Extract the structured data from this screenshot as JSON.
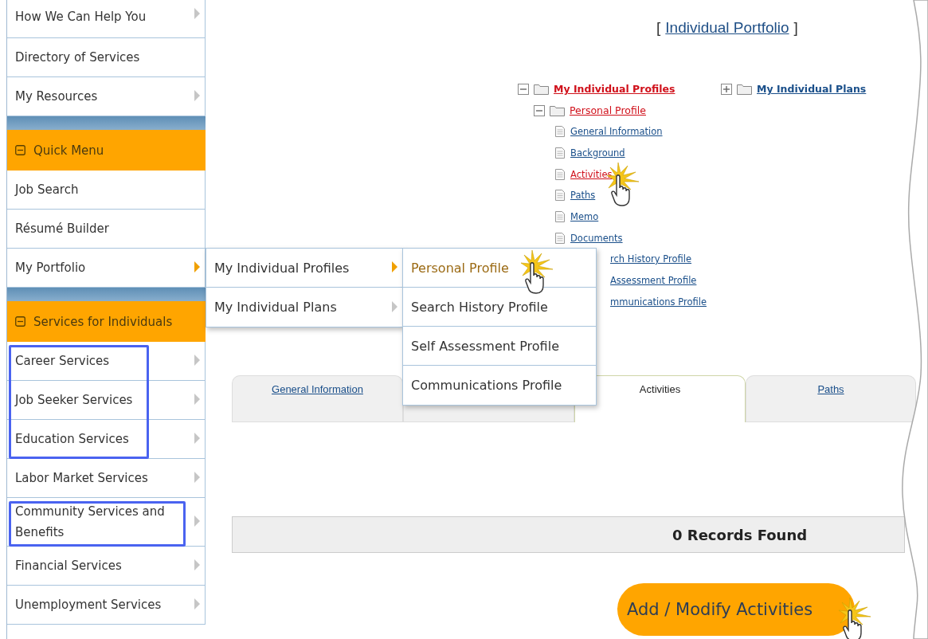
{
  "sidebar": [
    {
      "kind": "links",
      "items": [
        {
          "label": "How We Can Help You",
          "has_submenu": true,
          "expanded": false
        },
        {
          "label": "Directory of Services",
          "has_submenu": false,
          "expanded": false
        },
        {
          "label": "My Resources",
          "has_submenu": true,
          "expanded": false
        }
      ]
    },
    {
      "kind": "menu",
      "title": "Quick Menu",
      "expanded": true,
      "items": [
        {
          "label": "Job Search",
          "has_submenu": false,
          "expanded": false
        },
        {
          "label": "Résumé Builder",
          "has_submenu": false,
          "expanded": false
        },
        {
          "label": "My Portfolio",
          "has_submenu": true,
          "expanded": true
        }
      ]
    },
    {
      "kind": "menu",
      "title": "Services for Individuals",
      "expanded": true,
      "items": [
        {
          "label": "Career Services",
          "has_submenu": true,
          "expanded": false,
          "highlighted": true
        },
        {
          "label": "Job Seeker Services",
          "has_submenu": true,
          "expanded": false,
          "highlighted": true
        },
        {
          "label": "Education Services",
          "has_submenu": true,
          "expanded": false,
          "highlighted": true
        },
        {
          "label": "Labor Market Services",
          "has_submenu": true,
          "expanded": false,
          "highlighted": false
        },
        {
          "label": "Community Services and Benefits",
          "has_submenu": true,
          "expanded": false,
          "highlighted": true
        },
        {
          "label": "Financial Services",
          "has_submenu": true,
          "expanded": false,
          "highlighted": false
        },
        {
          "label": "Unemployment Services",
          "has_submenu": true,
          "expanded": false,
          "highlighted": false
        }
      ]
    }
  ],
  "flyouts": [
    {
      "items": [
        {
          "label": "My Individual Profiles",
          "has_submenu": true,
          "expanded": true
        },
        {
          "label": "My Individual Plans",
          "has_submenu": true,
          "expanded": false
        }
      ]
    },
    {
      "items": [
        {
          "label": "Personal Profile",
          "selected": true,
          "cursor": true
        },
        {
          "label": "Search History Profile",
          "selected": false,
          "cursor": false
        },
        {
          "label": "Self Assessment Profile",
          "selected": false,
          "cursor": false
        },
        {
          "label": "Communications Profile",
          "selected": false,
          "cursor": false
        }
      ]
    }
  ],
  "header": {
    "open": "[",
    "link": "Individual Portfolio",
    "close": "]"
  },
  "tree": [
    {
      "kind": "folder",
      "label": "My Individual Profiles",
      "expanded": true,
      "selected": true,
      "children": [
        {
          "kind": "folder",
          "label": "Personal Profile",
          "expanded": true,
          "selected": true,
          "children": [
            {
              "kind": "doc",
              "label": "General Information",
              "selected": false,
              "cursor": false
            },
            {
              "kind": "doc",
              "label": "Background",
              "selected": false,
              "cursor": false
            },
            {
              "kind": "doc",
              "label": "Activities",
              "selected": true,
              "cursor": true
            },
            {
              "kind": "doc",
              "label": "Paths",
              "selected": false,
              "cursor": false
            },
            {
              "kind": "doc",
              "label": "Memo",
              "selected": false,
              "cursor": false
            },
            {
              "kind": "doc",
              "label": "Documents",
              "selected": false,
              "cursor": false
            },
            {
              "kind": "clipped",
              "label": "rch History Profile",
              "selected": false,
              "cursor": false
            },
            {
              "kind": "clipped",
              "label": "Assessment Profile",
              "selected": false,
              "cursor": false
            },
            {
              "kind": "clipped",
              "label": "mmunications Profile",
              "selected": false,
              "cursor": false
            }
          ]
        }
      ]
    },
    {
      "kind": "folder",
      "label": "My Individual Plans",
      "expanded": false,
      "selected": false
    }
  ],
  "tabs": [
    {
      "label": "General Information",
      "selected": false
    },
    {
      "selected": false
    },
    {
      "label": "Activities",
      "selected": true
    },
    {
      "label": "Paths",
      "selected": false
    }
  ],
  "records": "0 Records Found",
  "button": {
    "label": "Add / Modify Activities",
    "cursor": true
  }
}
